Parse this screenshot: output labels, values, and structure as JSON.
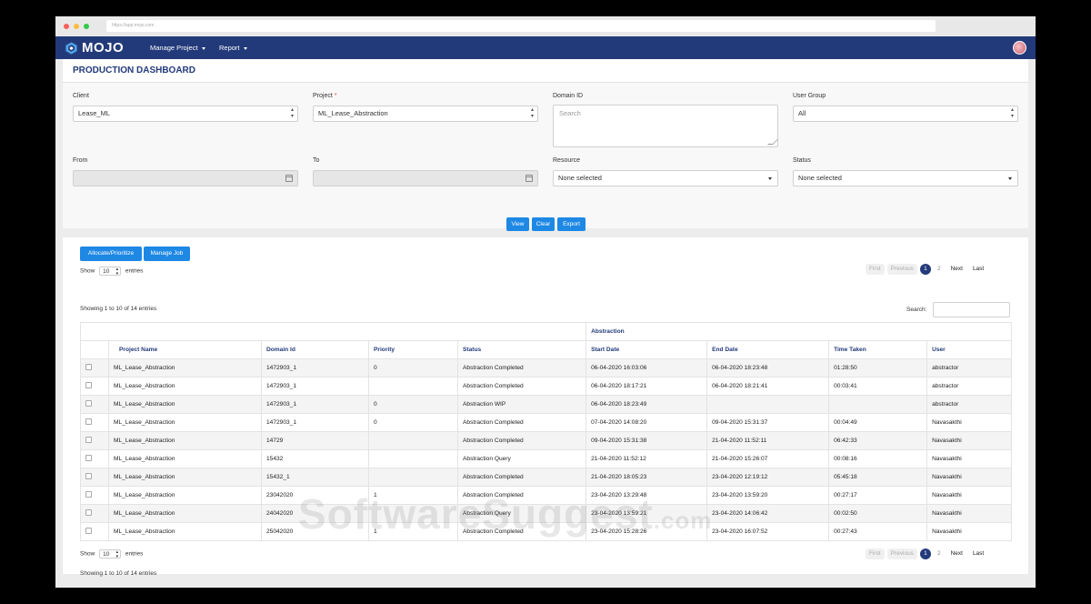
{
  "browser": {
    "url": "https://app.mojo.com"
  },
  "navbar": {
    "brand": "MOJO",
    "menus": [
      {
        "label": "Manage Project"
      },
      {
        "label": "Report"
      }
    ]
  },
  "page": {
    "title": "PRODUCTION DASHBOARD"
  },
  "filters": {
    "client": {
      "label": "Client",
      "value": "Lease_ML"
    },
    "project": {
      "label": "Project",
      "required_mark": "*",
      "value": "ML_Lease_Abstraction"
    },
    "domain_id": {
      "label": "Domain ID",
      "placeholder": "Search"
    },
    "user_group": {
      "label": "User Group",
      "value": "All"
    },
    "from": {
      "label": "From"
    },
    "to": {
      "label": "To"
    },
    "resource": {
      "label": "Resource",
      "value": "None selected"
    },
    "status": {
      "label": "Status",
      "value": "None selected"
    },
    "buttons": {
      "view": "View",
      "clear": "Clear",
      "export": "Export"
    }
  },
  "table_controls": {
    "allocate_button": "Allocate/Prioritize",
    "manage_job_button": "Manage Job",
    "show_label": "Show",
    "page_length": "10",
    "entries_label": "entries",
    "info": "Showing 1 to 10 of 14 entries",
    "search_label": "Search:",
    "pager": {
      "first": "First",
      "previous": "Previous",
      "pages": [
        "1",
        "2"
      ],
      "current": "1",
      "next": "Next",
      "last": "Last"
    }
  },
  "table": {
    "group_header": "Abstraction",
    "columns": [
      "Project Name",
      "Domain Id",
      "Priority",
      "Status",
      "Start Date",
      "End Date",
      "Time Taken",
      "User"
    ],
    "rows": [
      [
        "ML_Lease_Abstraction",
        "1472903_1",
        "0",
        "Abstraction Completed",
        "06-04-2020 16:03:06",
        "06-04-2020 18:23:48",
        "01:28:50",
        "abstractor"
      ],
      [
        "ML_Lease_Abstraction",
        "1472903_1",
        "",
        "Abstraction Completed",
        "06-04-2020 18:17:21",
        "06-04-2020 18:21:41",
        "00:03:41",
        "abstractor"
      ],
      [
        "ML_Lease_Abstraction",
        "1472903_1",
        "0",
        "Abstraction WIP",
        "06-04-2020 18:23:49",
        "",
        "",
        "abstractor"
      ],
      [
        "ML_Lease_Abstraction",
        "1472903_1",
        "0",
        "Abstraction Completed",
        "07-04-2020 14:08:20",
        "09-04-2020 15:31:37",
        "00:04:49",
        "Navasakthi"
      ],
      [
        "ML_Lease_Abstraction",
        "14729",
        "",
        "Abstraction Completed",
        "09-04-2020 15:31:38",
        "21-04-2020 11:52:11",
        "06:42:33",
        "Navasakthi"
      ],
      [
        "ML_Lease_Abstraction",
        "15432",
        "",
        "Abstraction Query",
        "21-04-2020 11:52:12",
        "21-04-2020 15:26:07",
        "00:08:16",
        "Navasakthi"
      ],
      [
        "ML_Lease_Abstraction",
        "15432_1",
        "",
        "Abstraction Completed",
        "21-04-2020 18:05:23",
        "23-04-2020 12:19:12",
        "05:45:18",
        "Navasakthi"
      ],
      [
        "ML_Lease_Abstraction",
        "23042020",
        "1",
        "Abstraction Completed",
        "23-04-2020 13:29:48",
        "23-04-2020 13:59:20",
        "00:27:17",
        "Navasakthi"
      ],
      [
        "ML_Lease_Abstraction",
        "24042020",
        "",
        "Abstraction Query",
        "23-04-2020 13:59:21",
        "23-04-2020 14:06:42",
        "00:02:50",
        "Navasakthi"
      ],
      [
        "ML_Lease_Abstraction",
        "25042020",
        "1",
        "Abstraction Completed",
        "23-04-2020 15:28:26",
        "23-04-2020 16:07:52",
        "00:27:43",
        "Navasakthi"
      ]
    ]
  },
  "watermark": {
    "main": "SoftwareSuggest",
    "suffix": ".com"
  },
  "colors": {
    "navbar": "#233a7a",
    "primary_button": "#1e88e5",
    "title": "#233a7a"
  }
}
